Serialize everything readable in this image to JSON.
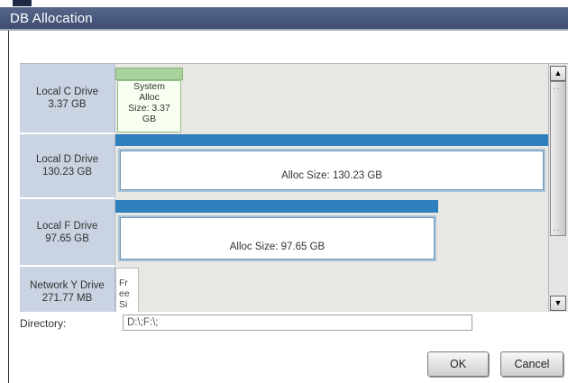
{
  "window": {
    "title": "DB Allocation"
  },
  "drives": [
    {
      "name": "Local C Drive",
      "size": "3.37 GB",
      "alloc_label": [
        "System",
        "Alloc",
        "Size: 3.37",
        "GB"
      ]
    },
    {
      "name": "Local D Drive",
      "size": "130.23 GB",
      "alloc_label": "Alloc Size: 130.23 GB"
    },
    {
      "name": "Local F Drive",
      "size": "97.65 GB",
      "alloc_label": "Alloc Size: 97.65 GB"
    },
    {
      "name": "Network Y Drive",
      "size": "271.77 MB",
      "free_label": [
        "Fr",
        "ee",
        "Si"
      ]
    }
  ],
  "scrollbar": {
    "up_icon": "scroll-up-arrow",
    "down_icon": "scroll-down-arrow"
  },
  "directory": {
    "label": "Directory:",
    "value": "D:\\;F:\\;"
  },
  "buttons": {
    "ok": "OK",
    "cancel": "Cancel"
  },
  "colors": {
    "title_bar": "#4a5b80",
    "alloc_bar": "#2f7fbd",
    "system_alloc": "#a9d39c",
    "drive_label_bg": "#c9d3e2",
    "panel_bg": "#e9e7e3"
  }
}
